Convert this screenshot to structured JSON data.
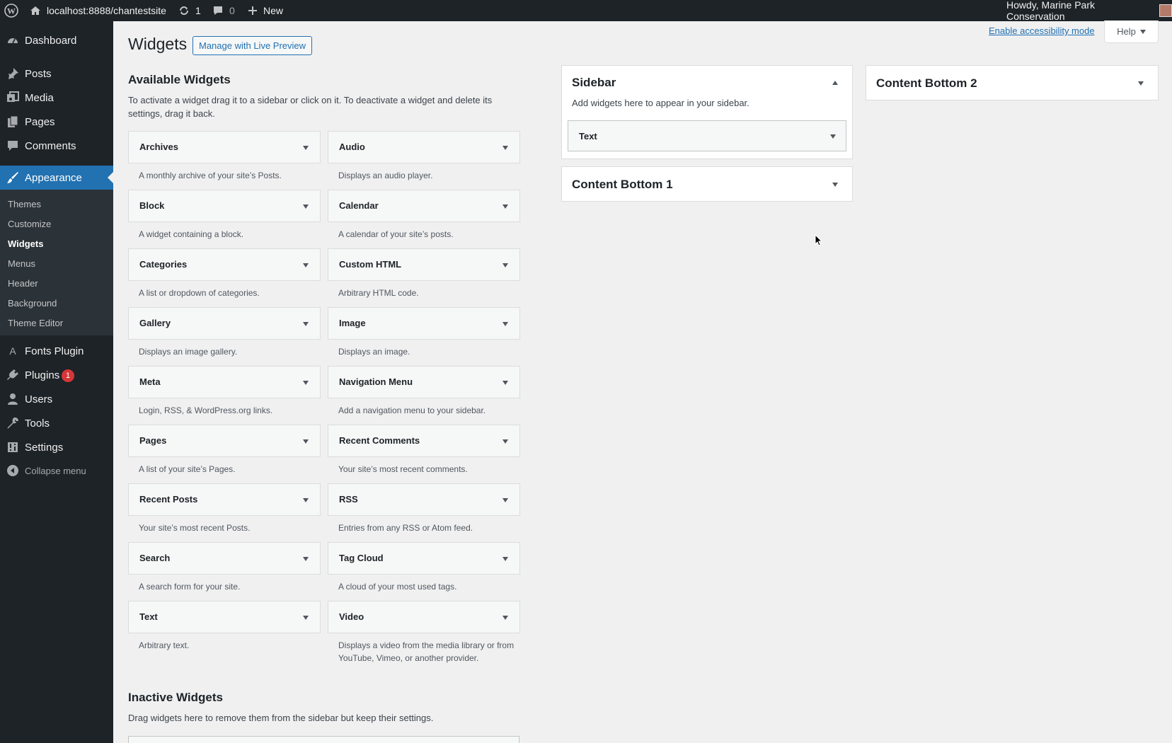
{
  "admin_bar": {
    "site_url": "localhost:8888/chantestsite",
    "updates_count": "1",
    "comments_count": "0",
    "new_label": "New",
    "greeting": "Howdy, Marine Park Conservation"
  },
  "menu": {
    "dashboard": "Dashboard",
    "posts": "Posts",
    "media": "Media",
    "pages": "Pages",
    "comments": "Comments",
    "appearance": "Appearance",
    "submenu": [
      "Themes",
      "Customize",
      "Widgets",
      "Menus",
      "Header",
      "Background",
      "Theme Editor"
    ],
    "fonts_plugin": "Fonts Plugin",
    "plugins": "Plugins",
    "plugins_badge": "1",
    "users": "Users",
    "tools": "Tools",
    "settings": "Settings",
    "collapse": "Collapse menu"
  },
  "header": {
    "title": "Widgets",
    "live_preview_button": "Manage with Live Preview",
    "accessibility_link": "Enable accessibility mode",
    "help_button": "Help"
  },
  "available": {
    "title": "Available Widgets",
    "description": "To activate a widget drag it to a sidebar or click on it. To deactivate a widget and delete its settings, drag it back.",
    "widgets": [
      {
        "name": "Archives",
        "desc": "A monthly archive of your site’s Posts."
      },
      {
        "name": "Audio",
        "desc": "Displays an audio player."
      },
      {
        "name": "Block",
        "desc": "A widget containing a block."
      },
      {
        "name": "Calendar",
        "desc": "A calendar of your site’s posts."
      },
      {
        "name": "Categories",
        "desc": "A list or dropdown of categories."
      },
      {
        "name": "Custom HTML",
        "desc": "Arbitrary HTML code."
      },
      {
        "name": "Gallery",
        "desc": "Displays an image gallery."
      },
      {
        "name": "Image",
        "desc": "Displays an image."
      },
      {
        "name": "Meta",
        "desc": "Login, RSS, & WordPress.org links."
      },
      {
        "name": "Navigation Menu",
        "desc": "Add a navigation menu to your sidebar."
      },
      {
        "name": "Pages",
        "desc": "A list of your site’s Pages."
      },
      {
        "name": "Recent Comments",
        "desc": "Your site’s most recent comments."
      },
      {
        "name": "Recent Posts",
        "desc": "Your site’s most recent Posts."
      },
      {
        "name": "RSS",
        "desc": "Entries from any RSS or Atom feed."
      },
      {
        "name": "Search",
        "desc": "A search form for your site."
      },
      {
        "name": "Tag Cloud",
        "desc": "A cloud of your most used tags."
      },
      {
        "name": "Text",
        "desc": "Arbitrary text."
      },
      {
        "name": "Video",
        "desc": "Displays a video from the media library or from YouTube, Vimeo, or another provider."
      }
    ]
  },
  "inactive": {
    "title": "Inactive Widgets",
    "description": "Drag widgets here to remove them from the sidebar but keep their settings."
  },
  "sidebars": {
    "sidebar": {
      "title": "Sidebar",
      "description": "Add widgets here to appear in your sidebar.",
      "widget": "Text"
    },
    "content_bottom_1": {
      "title": "Content Bottom 1"
    },
    "content_bottom_2": {
      "title": "Content Bottom 2"
    }
  },
  "colors": {
    "accent": "#2271b1",
    "menu_bg": "#1d2327",
    "badge": "#d63638"
  }
}
